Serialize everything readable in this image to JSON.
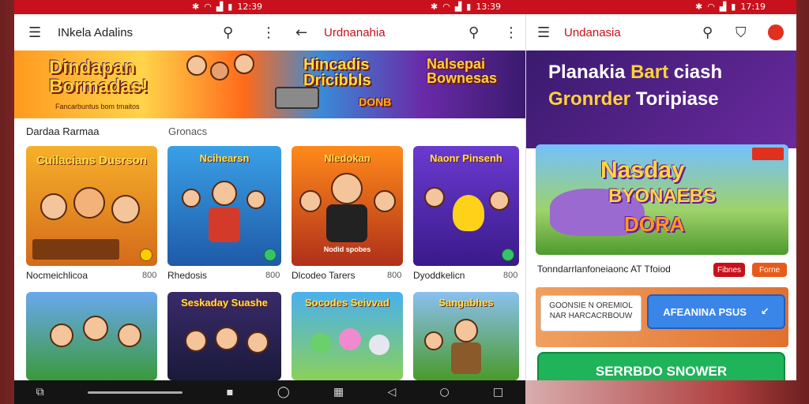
{
  "status": {
    "time_left": "12:39",
    "time_mid": "13:39",
    "time_right": "17:19",
    "icons": [
      "bluetooth-icon",
      "wifi-icon",
      "signal-icon",
      "battery-icon"
    ]
  },
  "left_screen": {
    "appbar": {
      "title": "INkela Adalins",
      "title_secondary": "Urdnanahia"
    },
    "banner": {
      "text_1": "Dindapan Bormadas!",
      "text_1_sub": "Fancarbuntus bom tmaitos",
      "text_2": "Hincadis Dricibbls",
      "text_2_sub": "DONB",
      "text_3": "Nalsepai Bownesas"
    },
    "sections": {
      "left": "Dardaa Rarmaa",
      "right": "Gronacs"
    },
    "cards_row1": [
      {
        "art": "Cuilacians Dusrson",
        "caption": "Nocmeichlicoa",
        "count": "800"
      },
      {
        "art": "Ncihearsn",
        "caption": "Rhedosis",
        "count": "800"
      },
      {
        "art": "Nledokan",
        "art_sub": "Nodid spobes",
        "caption": "Dlcodeo Tarers",
        "count": "800"
      },
      {
        "art": "Naonr Pinsenh",
        "caption": "Dyoddkelicn",
        "count": "800"
      }
    ],
    "cards_row2": [
      {
        "art": ""
      },
      {
        "art": "Seskaday Suashe"
      },
      {
        "art": "Socodes Seivvad"
      },
      {
        "art": "Sangabhes"
      }
    ]
  },
  "right_screen": {
    "appbar": {
      "title": "Undanasia"
    },
    "promo": {
      "line_1a": "Planakia",
      "line_1b": "Bart",
      "line_1c": "ciash",
      "line_2a": "Gronrder",
      "line_2b": "Toripiase"
    },
    "hero": {
      "line_1": "Nasday",
      "line_2": "BYONAEBS",
      "line_3": "DORA"
    },
    "info_line": "Tonndarrlanfoneiaonc AT Tfoiod",
    "tags": [
      "Fibnes",
      "Forne"
    ],
    "popup": {
      "line_1": "GOONSIE N OREMIOL",
      "line_2": "NAR HARCACRBOUW"
    },
    "secondary_button": "AFEANINA PSUS",
    "primary_button": "SERRBDO SNOWER"
  },
  "nav": {
    "left": [
      "recents-icon",
      "home-pill",
      "square-icon",
      "circle-icon",
      "grid-icon"
    ],
    "mid": [
      "back-icon",
      "home-icon",
      "overview-icon"
    ]
  },
  "colors": {
    "accent_red": "#c8111c",
    "green_button": "#1fb35a",
    "blue_button": "#3a86e8",
    "promo_purple": "#4a1f82",
    "promo_yellow": "#ffd23b"
  }
}
